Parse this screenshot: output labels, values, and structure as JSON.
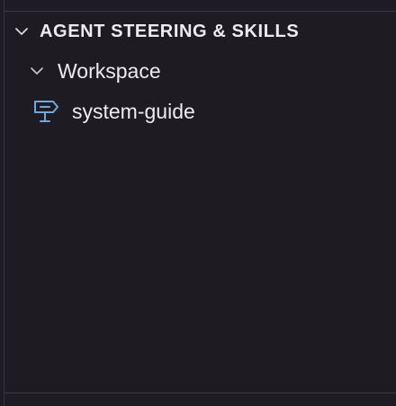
{
  "section": {
    "title": "AGENT STEERING & SKILLS",
    "chevron_icon": "chevron-down-icon"
  },
  "group": {
    "label": "Workspace",
    "chevron_icon": "chevron-down-icon"
  },
  "files": [
    {
      "label": "system-guide",
      "icon": "signpost-icon",
      "icon_color": "#6fa8e0"
    }
  ],
  "colors": {
    "background": "#1e1c22",
    "text": "#ececf0",
    "divider": "#3a3840"
  }
}
